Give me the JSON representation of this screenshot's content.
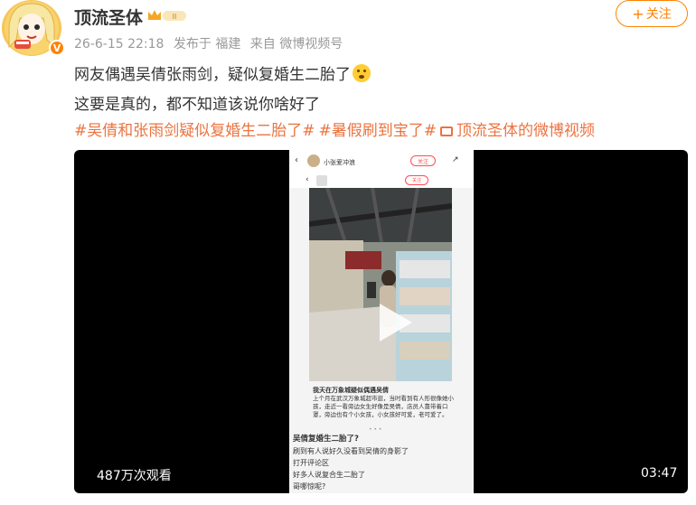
{
  "post": {
    "username": "顶流圣体",
    "verified_badge": "V",
    "level_badge": "II",
    "meta": {
      "date": "26-6-15 22:18",
      "location": "发布于 福建",
      "source": "来自 微博视频号"
    },
    "follow_label": "关注",
    "follow_plus": "+",
    "text_line1": "网友偶遇吴倩张雨剑，疑似复婚生二胎了",
    "text_line2": "这要是真的，都不知道该说你啥好了",
    "tags": [
      "#吴倩和张雨剑疑似复婚生二胎了#",
      "#暑假刷到宝了#",
      "顶流圣体的微博视频"
    ]
  },
  "video": {
    "views": "487万次观看",
    "duration": "03:47",
    "phone": {
      "top_name": "小张爱冲浪",
      "top_follow": "关注",
      "sub_follow": "关注",
      "caption_title": "我天在万象城疑似偶遇吴倩",
      "caption_body": "上个月在武汉万象城超市逛，当时看到有人形很像她小孩，走近一看旁边女生好像是吴倩，店员人靠带着口罩，旁边也有个小女孩，小女孩好可爱，老可爱了。",
      "dots": "• • •",
      "list_title": "吴倩复婚生二胎了?",
      "list_items": [
        "刷到有人说好久没看到吴倩的身影了",
        "打开评论区",
        "好多人说复合生二胎了",
        "哥哪惊呢?"
      ]
    }
  },
  "icons": {
    "avatar": "cartoon-girl-avatar",
    "crown": "crown-icon",
    "video": "video-icon",
    "play": "play-icon"
  },
  "colors": {
    "accent": "#ff8200",
    "tag": "#eb7340",
    "text": "#333333",
    "meta": "#999999"
  }
}
